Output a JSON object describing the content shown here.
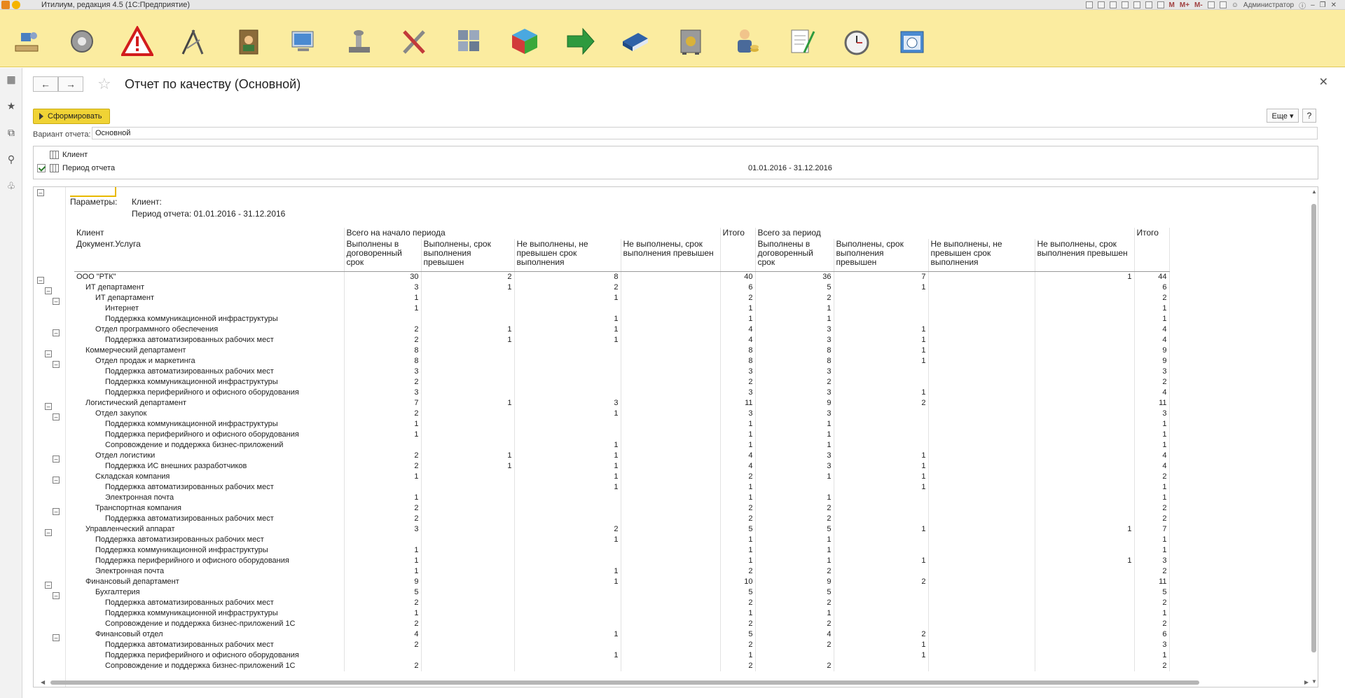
{
  "window": {
    "title": "Итилиум, редакция 4.5 (1С:Предприятие)",
    "user": "Администратор",
    "tool_labels": [
      "M",
      "M+",
      "M-"
    ]
  },
  "toolbar": {
    "icons": [
      "desk-icon",
      "gear-icon",
      "warning-icon",
      "tools-icon",
      "contacts-icon",
      "computer-icon",
      "stamp-icon",
      "wrench-icon",
      "modules-icon",
      "cube-icon",
      "arrow-icon",
      "book-icon",
      "safe-icon",
      "person-icon",
      "document-icon",
      "clock-icon",
      "calendar-icon"
    ]
  },
  "page": {
    "title": "Отчет по качеству (Основной)",
    "generate_label": "Сформировать",
    "more_label": "Еще ▾",
    "help_label": "?",
    "variant_label": "Вариант отчета:",
    "variant_value": "Основной"
  },
  "settings": [
    {
      "label": "Клиент",
      "checked": false,
      "value": ""
    },
    {
      "label": "Период отчета",
      "checked": true,
      "value": "01.01.2016 - 31.12.2016"
    }
  ],
  "params": {
    "label": "Параметры:",
    "client": "Клиент:",
    "period": "Период отчета: 01.01.2016 - 31.12.2016"
  },
  "report": {
    "header_row1": [
      "Клиент",
      "Всего на начало периода",
      "Итого",
      "Всего за период",
      "Итого"
    ],
    "header_row2": [
      "Документ.Услуга",
      "Выполнены в договоренный срок",
      "Выполнены, срок выполнения превышен",
      "Не выполнены, не превышен срок выполнения",
      "Не выполнены, срок выполнения превышен",
      "",
      "Выполнены в договоренный срок",
      "Выполнены, срок выполнения превышен",
      "Не выполнены, не превышен срок выполнения",
      "Не выполнены, срок выполнения превышен",
      ""
    ],
    "rows": [
      {
        "level": 0,
        "name": "ООО \"РТК\"",
        "v": [
          "30",
          "2",
          "8",
          "",
          "40",
          "36",
          "7",
          "",
          "1",
          "44"
        ]
      },
      {
        "level": 1,
        "name": "ИТ департамент",
        "v": [
          "3",
          "1",
          "2",
          "",
          "6",
          "5",
          "1",
          "",
          "",
          "6"
        ]
      },
      {
        "level": 2,
        "name": "ИТ департамент",
        "v": [
          "1",
          "",
          "1",
          "",
          "2",
          "2",
          "",
          "",
          "",
          "2"
        ]
      },
      {
        "level": 3,
        "name": "Интернет",
        "v": [
          "1",
          "",
          "",
          "",
          "1",
          "1",
          "",
          "",
          "",
          "1"
        ]
      },
      {
        "level": 3,
        "name": "Поддержка коммуникационной инфраструктуры",
        "v": [
          "",
          "",
          "1",
          "",
          "1",
          "1",
          "",
          "",
          "",
          "1"
        ]
      },
      {
        "level": 2,
        "name": "Отдел программного обеспечения",
        "v": [
          "2",
          "1",
          "1",
          "",
          "4",
          "3",
          "1",
          "",
          "",
          "4"
        ]
      },
      {
        "level": 3,
        "name": "Поддержка автоматизированных рабочих мест",
        "v": [
          "2",
          "1",
          "1",
          "",
          "4",
          "3",
          "1",
          "",
          "",
          "4"
        ]
      },
      {
        "level": 1,
        "name": "Коммерческий департамент",
        "v": [
          "8",
          "",
          "",
          "",
          "8",
          "8",
          "1",
          "",
          "",
          "9"
        ]
      },
      {
        "level": 2,
        "name": "Отдел продаж и маркетинга",
        "v": [
          "8",
          "",
          "",
          "",
          "8",
          "8",
          "1",
          "",
          "",
          "9"
        ]
      },
      {
        "level": 3,
        "name": "Поддержка автоматизированных рабочих мест",
        "v": [
          "3",
          "",
          "",
          "",
          "3",
          "3",
          "",
          "",
          "",
          "3"
        ]
      },
      {
        "level": 3,
        "name": "Поддержка коммуникационной инфраструктуры",
        "v": [
          "2",
          "",
          "",
          "",
          "2",
          "2",
          "",
          "",
          "",
          "2"
        ]
      },
      {
        "level": 3,
        "name": "Поддержка периферийного и офисного оборудования",
        "v": [
          "3",
          "",
          "",
          "",
          "3",
          "3",
          "1",
          "",
          "",
          "4"
        ]
      },
      {
        "level": 1,
        "name": "Логистический департамент",
        "v": [
          "7",
          "1",
          "3",
          "",
          "11",
          "9",
          "2",
          "",
          "",
          "11"
        ]
      },
      {
        "level": 2,
        "name": "Отдел закупок",
        "v": [
          "2",
          "",
          "1",
          "",
          "3",
          "3",
          "",
          "",
          "",
          "3"
        ]
      },
      {
        "level": 3,
        "name": "Поддержка коммуникационной инфраструктуры",
        "v": [
          "1",
          "",
          "",
          "",
          "1",
          "1",
          "",
          "",
          "",
          "1"
        ]
      },
      {
        "level": 3,
        "name": "Поддержка периферийного и офисного оборудования",
        "v": [
          "1",
          "",
          "",
          "",
          "1",
          "1",
          "",
          "",
          "",
          "1"
        ]
      },
      {
        "level": 3,
        "name": "Сопровождение и поддержка бизнес-приложений",
        "v": [
          "",
          "",
          "1",
          "",
          "1",
          "1",
          "",
          "",
          "",
          "1"
        ]
      },
      {
        "level": 2,
        "name": "Отдел логистики",
        "v": [
          "2",
          "1",
          "1",
          "",
          "4",
          "3",
          "1",
          "",
          "",
          "4"
        ]
      },
      {
        "level": 3,
        "name": "Поддержка ИС внешних разработчиков",
        "v": [
          "2",
          "1",
          "1",
          "",
          "4",
          "3",
          "1",
          "",
          "",
          "4"
        ]
      },
      {
        "level": 2,
        "name": "Складская компания",
        "v": [
          "1",
          "",
          "1",
          "",
          "2",
          "1",
          "1",
          "",
          "",
          "2"
        ]
      },
      {
        "level": 3,
        "name": "Поддержка автоматизированных рабочих мест",
        "v": [
          "",
          "",
          "1",
          "",
          "1",
          "",
          "1",
          "",
          "",
          "1"
        ]
      },
      {
        "level": 3,
        "name": "Электронная почта",
        "v": [
          "1",
          "",
          "",
          "",
          "1",
          "1",
          "",
          "",
          "",
          "1"
        ]
      },
      {
        "level": 2,
        "name": "Транспортная компания",
        "v": [
          "2",
          "",
          "",
          "",
          "2",
          "2",
          "",
          "",
          "",
          "2"
        ]
      },
      {
        "level": 3,
        "name": "Поддержка автоматизированных рабочих мест",
        "v": [
          "2",
          "",
          "",
          "",
          "2",
          "2",
          "",
          "",
          "",
          "2"
        ]
      },
      {
        "level": 1,
        "name": "Управленческий аппарат",
        "v": [
          "3",
          "",
          "2",
          "",
          "5",
          "5",
          "1",
          "",
          "1",
          "7"
        ]
      },
      {
        "level": 2,
        "name": "Поддержка автоматизированных рабочих мест",
        "v": [
          "",
          "",
          "1",
          "",
          "1",
          "1",
          "",
          "",
          "",
          "1"
        ]
      },
      {
        "level": 2,
        "name": "Поддержка коммуникационной инфраструктуры",
        "v": [
          "1",
          "",
          "",
          "",
          "1",
          "1",
          "",
          "",
          "",
          "1"
        ]
      },
      {
        "level": 2,
        "name": "Поддержка периферийного и офисного оборудования",
        "v": [
          "1",
          "",
          "",
          "",
          "1",
          "1",
          "1",
          "",
          "1",
          "3"
        ]
      },
      {
        "level": 2,
        "name": "Электронная почта",
        "v": [
          "1",
          "",
          "1",
          "",
          "2",
          "2",
          "",
          "",
          "",
          "2"
        ]
      },
      {
        "level": 1,
        "name": "Финансовый департамент",
        "v": [
          "9",
          "",
          "1",
          "",
          "10",
          "9",
          "2",
          "",
          "",
          "11"
        ]
      },
      {
        "level": 2,
        "name": "Бухгалтерия",
        "v": [
          "5",
          "",
          "",
          "",
          "5",
          "5",
          "",
          "",
          "",
          "5"
        ]
      },
      {
        "level": 3,
        "name": "Поддержка автоматизированных рабочих мест",
        "v": [
          "2",
          "",
          "",
          "",
          "2",
          "2",
          "",
          "",
          "",
          "2"
        ]
      },
      {
        "level": 3,
        "name": "Поддержка коммуникационной инфраструктуры",
        "v": [
          "1",
          "",
          "",
          "",
          "1",
          "1",
          "",
          "",
          "",
          "1"
        ]
      },
      {
        "level": 3,
        "name": "Сопровождение и поддержка бизнес-приложений 1С",
        "v": [
          "2",
          "",
          "",
          "",
          "2",
          "2",
          "",
          "",
          "",
          "2"
        ]
      },
      {
        "level": 2,
        "name": "Финансовый отдел",
        "v": [
          "4",
          "",
          "1",
          "",
          "5",
          "4",
          "2",
          "",
          "",
          "6"
        ]
      },
      {
        "level": 3,
        "name": "Поддержка автоматизированных рабочих мест",
        "v": [
          "2",
          "",
          "",
          "",
          "2",
          "2",
          "1",
          "",
          "",
          "3"
        ]
      },
      {
        "level": 3,
        "name": "Поддержка периферийного и офисного оборудования",
        "v": [
          "",
          "",
          "1",
          "",
          "1",
          "",
          "1",
          "",
          "",
          "1"
        ]
      },
      {
        "level": 3,
        "name": "Сопровождение и поддержка бизнес-приложений 1С",
        "v": [
          "2",
          "",
          "",
          "",
          "2",
          "2",
          "",
          "",
          "",
          "2"
        ]
      }
    ]
  }
}
